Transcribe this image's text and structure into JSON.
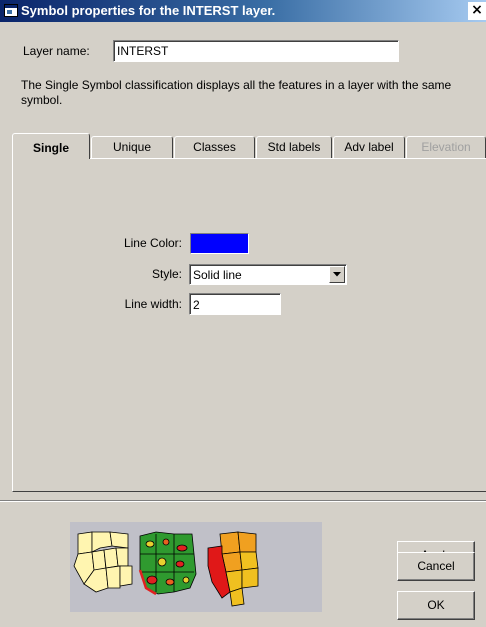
{
  "window": {
    "title": "Symbol properties for the INTERST layer.",
    "close_glyph": "×"
  },
  "layer": {
    "label": "Layer name:",
    "value": "INTERST"
  },
  "description": "The Single Symbol classification displays all the features in a layer with the same symbol.",
  "tabs": [
    {
      "label": "Single",
      "active": true
    },
    {
      "label": "Unique"
    },
    {
      "label": "Classes"
    },
    {
      "label": "Std labels"
    },
    {
      "label": "Adv label"
    },
    {
      "label": "Elevation",
      "disabled": true
    }
  ],
  "fields": {
    "line_color_label": "Line Color:",
    "line_color_value": "#0000ff",
    "style_label": "Style:",
    "style_value": "Solid line",
    "width_label": "Line width:",
    "width_value": "2"
  },
  "buttons": {
    "apply": "Apply",
    "cancel": "Cancel",
    "ok": "OK"
  },
  "icons": {
    "title": "window-icon",
    "dropdown": "chevron-down-icon",
    "preview": "map-preview-image"
  }
}
